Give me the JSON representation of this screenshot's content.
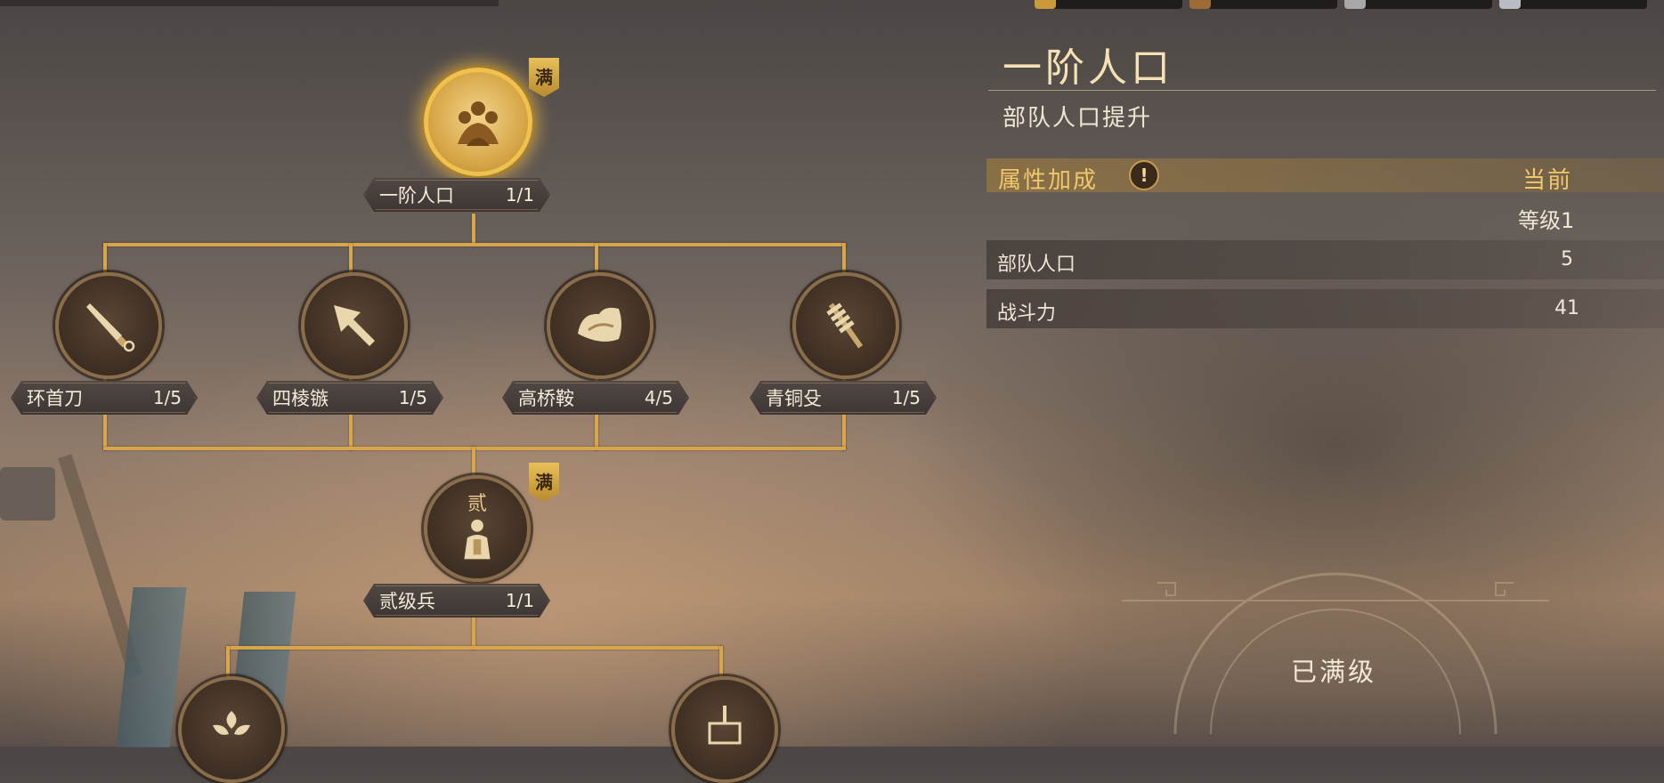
{
  "panel": {
    "title": "一阶人口",
    "subtitle": "部队人口提升",
    "attr_header": "属性加成",
    "current_header": "当前",
    "level_label": "等级1",
    "stats": [
      {
        "name": "部队人口",
        "value": "5"
      },
      {
        "name": "战斗力",
        "value": "41"
      }
    ],
    "max_text": "已满级"
  },
  "tree": {
    "max_badge": "满",
    "tier2_char": "贰",
    "nodes": [
      {
        "label": "一阶人口",
        "value": "1/1",
        "icon": "soldiers-group-icon"
      },
      {
        "label": "环首刀",
        "value": "1/5",
        "icon": "blade-icon"
      },
      {
        "label": "四棱镞",
        "value": "1/5",
        "icon": "arrowhead-icon"
      },
      {
        "label": "高桥鞍",
        "value": "4/5",
        "icon": "saddle-icon"
      },
      {
        "label": "青铜殳",
        "value": "1/5",
        "icon": "mace-icon"
      },
      {
        "label": "贰级兵",
        "value": "1/1",
        "icon": "armored-soldier-icon"
      }
    ]
  },
  "resources": [
    {
      "icon": "wheat-icon",
      "color": "#c99a3a"
    },
    {
      "icon": "wood-icon",
      "color": "#a06a38"
    },
    {
      "icon": "stone-icon",
      "color": "#a8a8a8"
    },
    {
      "icon": "iron-icon",
      "color": "#b8bcc4"
    }
  ],
  "colors": {
    "gold": "#d8a54a",
    "accent": "#f0c86a"
  }
}
